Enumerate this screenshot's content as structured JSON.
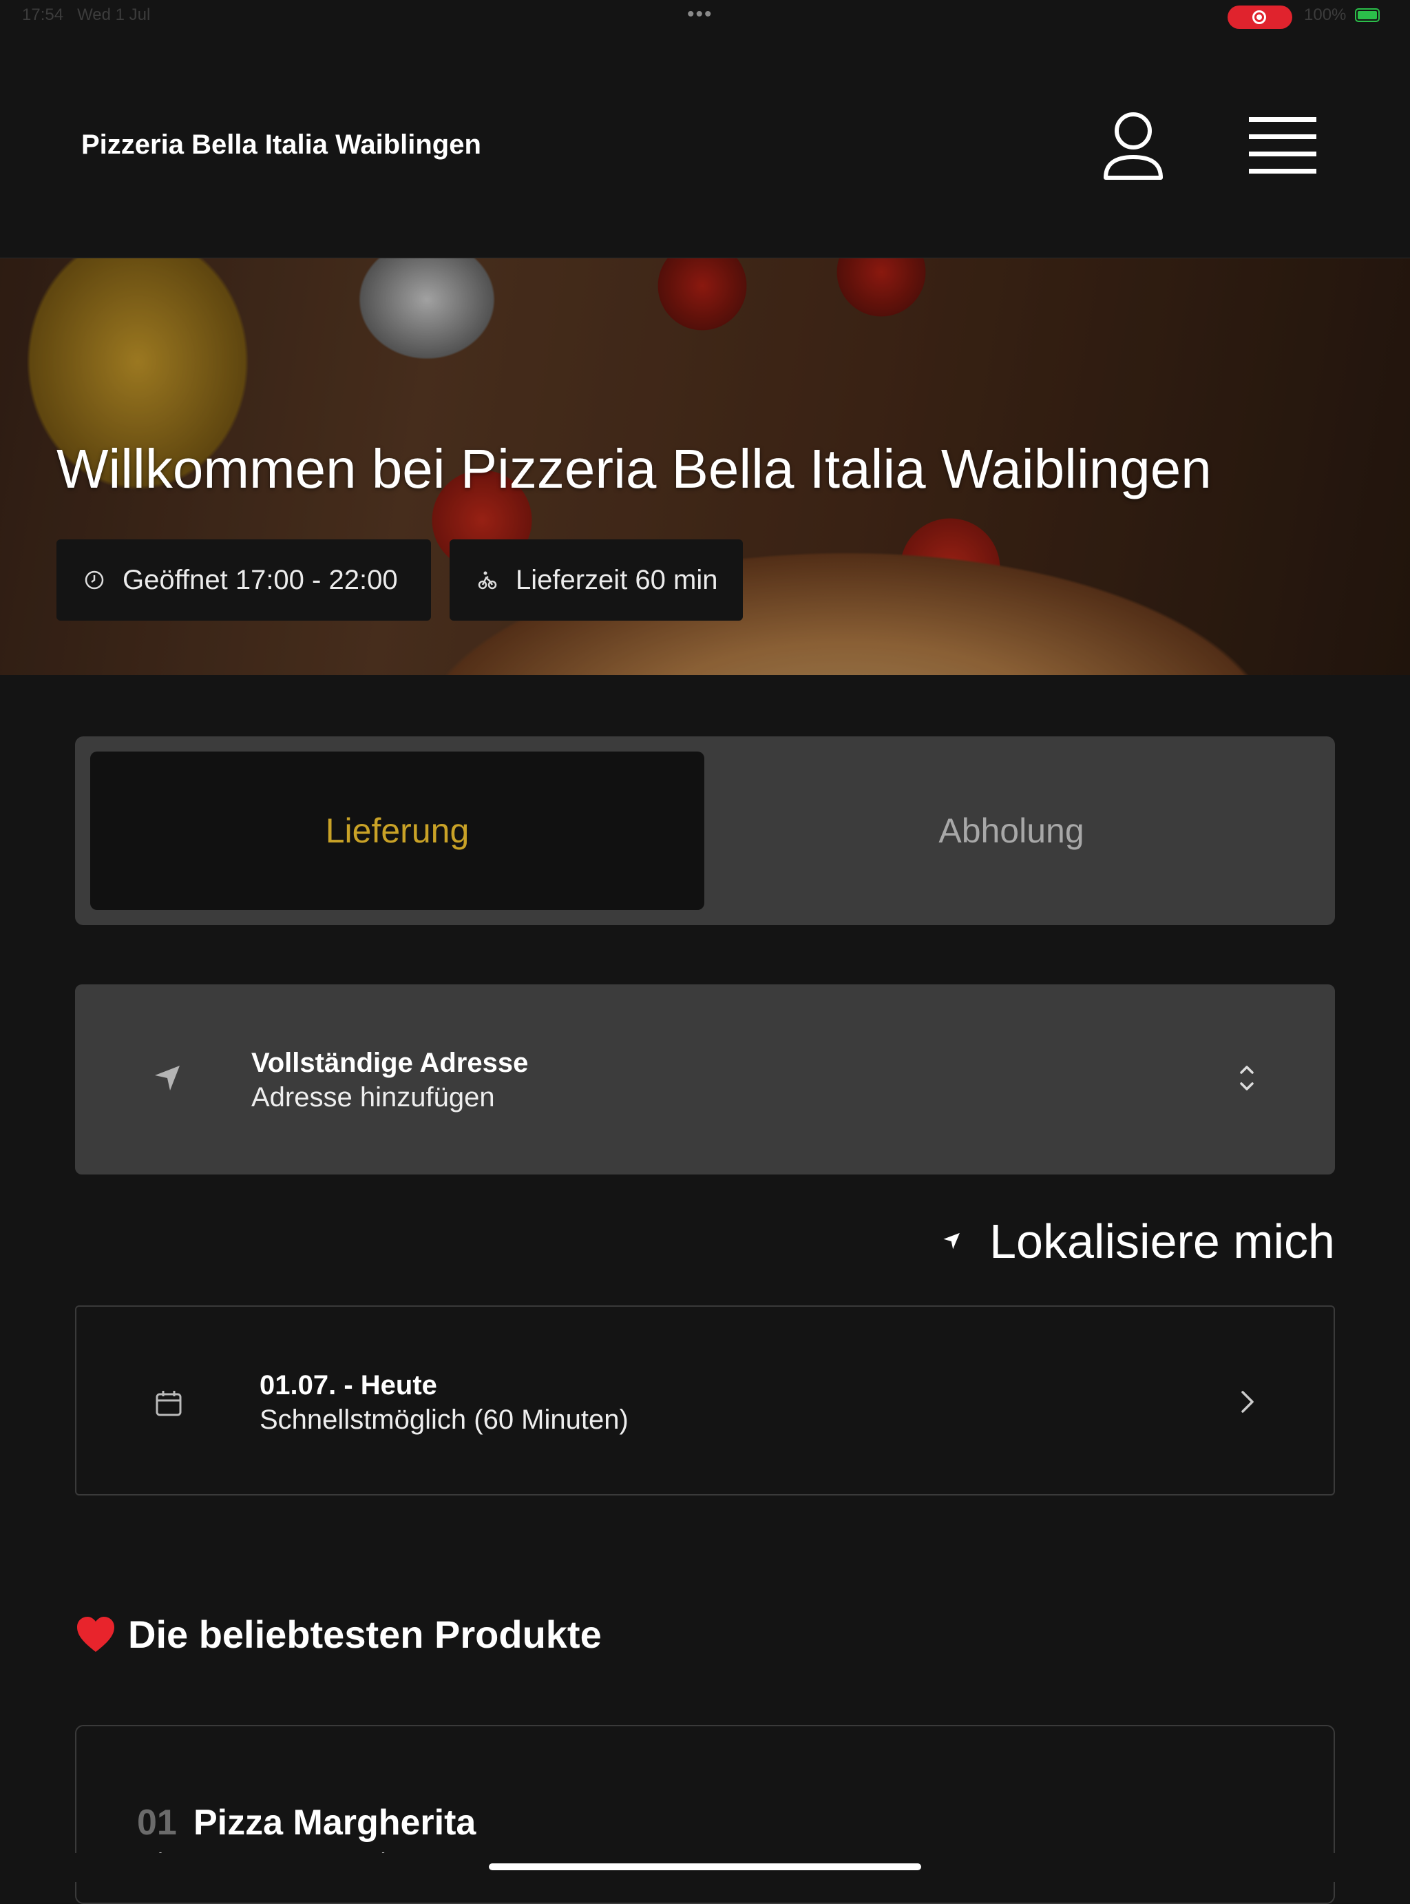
{
  "status_bar": {
    "time": "17:54",
    "date": "Wed 1 Jul",
    "battery": "100%",
    "dots": "•••"
  },
  "header": {
    "brand": "Pizzeria Bella Italia Waiblingen",
    "user_icon": "user-icon",
    "menu_icon": "hamburger-menu-icon"
  },
  "hero": {
    "title": "Willkommen bei Pizzeria Bella Italia Waiblingen",
    "open_hours": "Geöffnet 17:00 - 22:00",
    "delivery_time": "Lieferzeit 60 min"
  },
  "order_type": {
    "tabs": [
      {
        "label": "Lieferung",
        "active": true
      },
      {
        "label": "Abholung",
        "active": false
      }
    ],
    "active_color": "#c9a227"
  },
  "address": {
    "label": "Vollständige Adresse",
    "value": "Adresse hinzufügen"
  },
  "locate": {
    "label": "Lokalisiere mich"
  },
  "schedule": {
    "label": "01.07. - Heute",
    "value": "Schnellstmöglich (60 Minuten)"
  },
  "popular": {
    "title": "Die beliebtesten Produkte",
    "products": [
      {
        "number": "01",
        "name": "Pizza Margherita",
        "description": "mit Tomatensauce und Käse"
      }
    ]
  }
}
